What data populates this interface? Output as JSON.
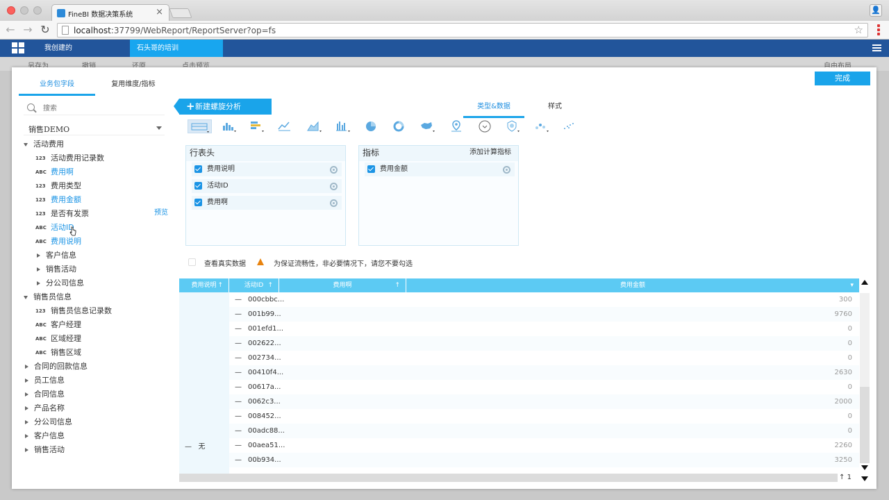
{
  "browser": {
    "tab_title": "FineBI 数据决策系统",
    "url_host": "localhost",
    "url_path": ":37799/WebReport/ReportServer?op=fs"
  },
  "app": {
    "tabs": [
      "我创建的",
      "石头哥的培训"
    ],
    "toolbar_behind": [
      "另存为",
      "撤销",
      "还原",
      "点击预览",
      "自由布局"
    ]
  },
  "left_panel": {
    "tabs": [
      "业务包字段",
      "复用维度/指标"
    ],
    "search_placeholder": "搜索",
    "package": "销售DEMO",
    "preview_label": "预览",
    "tree": [
      {
        "label": "活动费用",
        "kind": "group",
        "state": "open",
        "depth": 0
      },
      {
        "label": "活动费用记录数",
        "kind": "field",
        "type": "123",
        "depth": 1
      },
      {
        "label": "费用啊",
        "kind": "field",
        "type": "ABC",
        "depth": 1,
        "highlight": true
      },
      {
        "label": "费用类型",
        "kind": "field",
        "type": "123",
        "depth": 1
      },
      {
        "label": "费用金额",
        "kind": "field",
        "type": "123",
        "depth": 1,
        "highlight": true
      },
      {
        "label": "是否有发票",
        "kind": "field",
        "type": "123",
        "depth": 1
      },
      {
        "label": "活动ID",
        "kind": "field",
        "type": "ABC",
        "depth": 1,
        "highlight": true
      },
      {
        "label": "费用说明",
        "kind": "field",
        "type": "ABC",
        "depth": 1,
        "highlight": true
      },
      {
        "label": "客户信息",
        "kind": "group",
        "state": "closed",
        "depth": 1
      },
      {
        "label": "销售活动",
        "kind": "group",
        "state": "closed",
        "depth": 1
      },
      {
        "label": "分公司信息",
        "kind": "group",
        "state": "closed",
        "depth": 1
      },
      {
        "label": "销售员信息",
        "kind": "group",
        "state": "open",
        "depth": 0
      },
      {
        "label": "销售员信息记录数",
        "kind": "field",
        "type": "123",
        "depth": 1
      },
      {
        "label": "客户经理",
        "kind": "field",
        "type": "ABC",
        "depth": 1
      },
      {
        "label": "区域经理",
        "kind": "field",
        "type": "ABC",
        "depth": 1
      },
      {
        "label": "销售区域",
        "kind": "field",
        "type": "ABC",
        "depth": 1
      },
      {
        "label": "合同的回款信息",
        "kind": "group",
        "state": "closed",
        "depth": 0
      },
      {
        "label": "员工信息",
        "kind": "group",
        "state": "closed",
        "depth": 0
      },
      {
        "label": "合同信息",
        "kind": "group",
        "state": "closed",
        "depth": 0
      },
      {
        "label": "产品名称",
        "kind": "group",
        "state": "closed",
        "depth": 0
      },
      {
        "label": "分公司信息",
        "kind": "group",
        "state": "closed",
        "depth": 0
      },
      {
        "label": "客户信息",
        "kind": "group",
        "state": "closed",
        "depth": 0
      },
      {
        "label": "销售活动",
        "kind": "group",
        "state": "closed",
        "depth": 0
      }
    ]
  },
  "right_panel": {
    "new_button": "新建螺旋分析",
    "tabs": [
      "类型&数据",
      "样式"
    ],
    "done_button": "完成",
    "chart_icons": [
      "table-icon",
      "bar-chart-icon",
      "stacked-bar-icon",
      "line-chart-icon",
      "area-chart-icon",
      "column-chart-icon",
      "pie-chart-icon",
      "donut-chart-icon",
      "map-icon",
      "pin-map-icon",
      "gauge-icon",
      "shield-map-icon",
      "scatter-icon",
      "dot-chart-icon"
    ],
    "row_header": {
      "title": "行表头",
      "fields": [
        "费用说明",
        "活动ID",
        "费用啊"
      ]
    },
    "metrics": {
      "title": "指标",
      "action": "添加计算指标",
      "fields": [
        "费用金额"
      ]
    },
    "real_data_label": "查看真实数据",
    "warning_text": "为保证流畅性，非必要情况下，请您不要勾选"
  },
  "table": {
    "headers": [
      "费用说明",
      "活动ID",
      "费用啊",
      "费用金额"
    ],
    "group_value": "无",
    "rows": [
      {
        "id": "000cbbc...",
        "amount": "300"
      },
      {
        "id": "001b99...",
        "amount": "9760"
      },
      {
        "id": "001efd1...",
        "amount": "0"
      },
      {
        "id": "002622...",
        "amount": "0"
      },
      {
        "id": "002734...",
        "amount": "0"
      },
      {
        "id": "00410f4...",
        "amount": "2630"
      },
      {
        "id": "00617a...",
        "amount": "0"
      },
      {
        "id": "0062c3...",
        "amount": "2000"
      },
      {
        "id": "008452...",
        "amount": "0"
      },
      {
        "id": "00adc88...",
        "amount": "0"
      },
      {
        "id": "00aea51...",
        "amount": "2260"
      },
      {
        "id": "00b934...",
        "amount": "3250"
      }
    ],
    "page": "1"
  },
  "colors": {
    "accent": "#1aa4ea",
    "header_bar": "#22559b",
    "table_header": "#5ccaf3",
    "link_blue": "#1b94e5",
    "warning": "#e8830f"
  }
}
